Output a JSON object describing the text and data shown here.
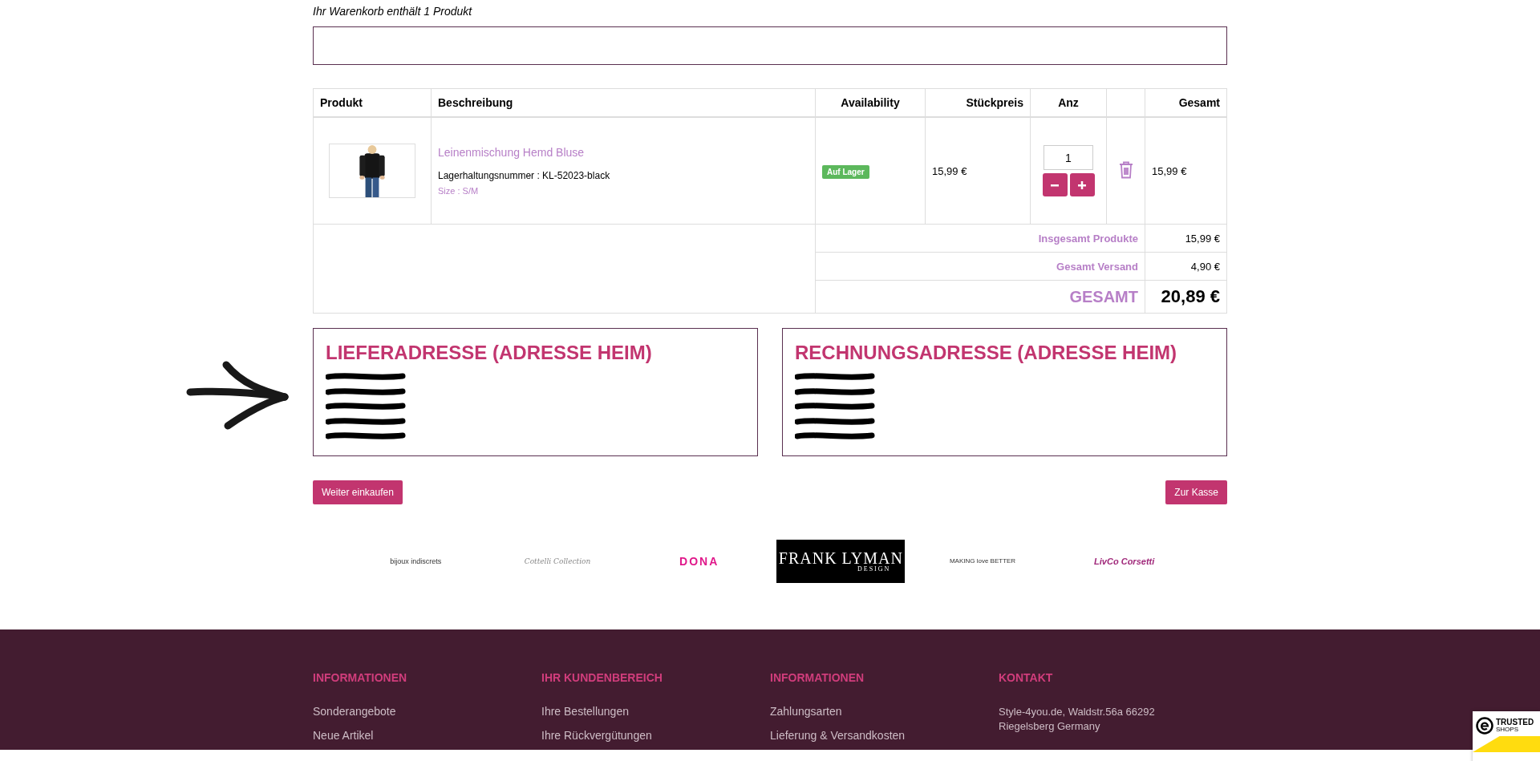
{
  "cart_summary": "Ihr Warenkorb enthält 1 Produkt",
  "table": {
    "columns": [
      "Produkt",
      "Beschreibung",
      "Availability",
      "Stückpreis",
      "Anz",
      "Gesamt"
    ],
    "rows": [
      {
        "name": "Leinenmischung Hemd Bluse",
        "sku": "Lagerhaltungsnummer : KL-52023-black",
        "size": "Size : S/M",
        "availability": "Auf Lager",
        "unit_price": "15,99 €",
        "quantity": "1",
        "total": "15,99 €"
      }
    ],
    "totals": [
      {
        "label": "Insgesamt Produkte",
        "value": "15,99 €",
        "kind": "normal"
      },
      {
        "label": "Gesamt Versand",
        "value": "4,90 €",
        "kind": "normal"
      },
      {
        "label": "GESAMT",
        "value": "20,89 €",
        "kind": "grand"
      }
    ]
  },
  "annotation": {
    "kind": "arrow"
  },
  "addresses": [
    {
      "title": "LIEFERADRESSE (ADRESSE HEIM)",
      "lines": [
        {
          "kind": "redacted"
        },
        {
          "kind": "redacted"
        },
        {
          "kind": "redacted"
        },
        {
          "kind": "redacted"
        },
        {
          "kind": "redacted"
        }
      ]
    },
    {
      "title": "RECHNUNGSADRESSE (ADRESSE HEIM)",
      "lines": [
        {
          "kind": "redacted"
        },
        {
          "kind": "redacted"
        },
        {
          "kind": "redacted"
        },
        {
          "kind": "redacted"
        },
        {
          "kind": "redacted"
        }
      ]
    }
  ],
  "buttons": {
    "continue": "Weiter einkaufen",
    "checkout": "Zur Kasse"
  },
  "brands": [
    {
      "kind": "plain",
      "text": "bijoux indiscrets"
    },
    {
      "kind": "script",
      "text": "Cottelli Collection"
    },
    {
      "kind": "pink",
      "text": "DONA"
    },
    {
      "kind": "boxed",
      "text": "FRANK LYMAN",
      "sub": "DESIGN"
    },
    {
      "kind": "tiny",
      "text": "MAKING love BETTER"
    },
    {
      "kind": "swirl",
      "text": "LivCo Corsetti"
    }
  ],
  "footer": {
    "columns": [
      {
        "heading": "INFORMATIONEN",
        "items": [
          "Sonderangebote",
          "Neue Artikel"
        ]
      },
      {
        "heading": "IHR KUNDENBEREICH",
        "items": [
          "Ihre Bestellungen",
          "Ihre Rückvergütungen"
        ]
      },
      {
        "heading": "INFORMATIONEN",
        "items": [
          "Zahlungsarten",
          "Lieferung & Versandkosten"
        ]
      },
      {
        "heading": "KONTAKT",
        "text": "Style-4you.de, Waldstr.56a 66292 Riegelsberg Germany"
      }
    ]
  },
  "trust_badge": {
    "title": "TRUSTED",
    "subtitle": "SHOPS"
  }
}
